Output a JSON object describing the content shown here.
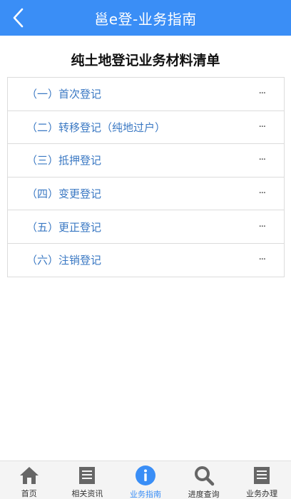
{
  "header": {
    "title": "邕e登-业务指南"
  },
  "page_title": "纯土地登记业务材料清单",
  "list": [
    {
      "label": "（一）首次登记",
      "more": "···"
    },
    {
      "label": "（二）转移登记（纯地过户）",
      "more": "···"
    },
    {
      "label": "（三）抵押登记",
      "more": "···"
    },
    {
      "label": "（四）变更登记",
      "more": "···"
    },
    {
      "label": "（五）更正登记",
      "more": "···"
    },
    {
      "label": "（六）注销登记",
      "more": "···"
    }
  ],
  "tabbar": [
    {
      "label": "首页",
      "icon": "home-icon"
    },
    {
      "label": "相关资讯",
      "icon": "news-icon"
    },
    {
      "label": "业务指南",
      "icon": "info-icon",
      "active": true
    },
    {
      "label": "进度查询",
      "icon": "search-icon"
    },
    {
      "label": "业务办理",
      "icon": "document-icon"
    }
  ],
  "colors": {
    "primary": "#3a8ef6",
    "link": "#3a78c3",
    "icon_gray": "#666666"
  }
}
